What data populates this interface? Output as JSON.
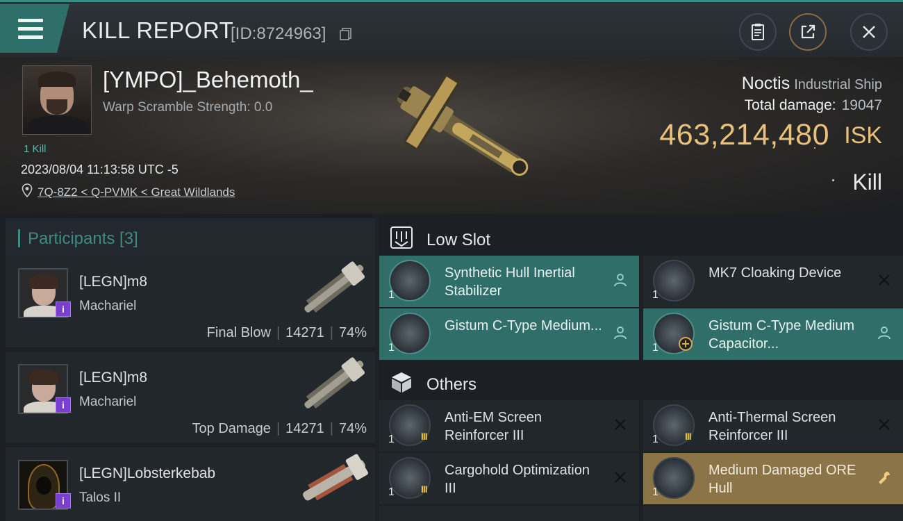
{
  "topbar": {
    "title": "KILL REPORT",
    "report_id": "[ID:8724963]"
  },
  "victim": {
    "name": "[YMPO]_Behemoth_",
    "warp_scramble": "Warp Scramble Strength: 0.0",
    "kill_count": "1 Kill",
    "date": "2023/08/04 11:13:58 UTC -5",
    "location": "7Q-8Z2 < Q-PVMK < Great Wildlands",
    "ship_name": "Noctis",
    "ship_class": "Industrial Ship",
    "total_damage_label": "Total damage:",
    "total_damage": "19047",
    "isk_value": "463,214,480",
    "isk_unit": "ISK",
    "kill_type": "Kill"
  },
  "participants": {
    "title": "Participants [3]",
    "rows": [
      {
        "name": "[LEGN]m8",
        "ship": "Machariel",
        "role": "Final Blow",
        "damage": "14271",
        "percent": "74%",
        "badge": "i"
      },
      {
        "name": "[LEGN]m8",
        "ship": "Machariel",
        "role": "Top Damage",
        "damage": "14271",
        "percent": "74%",
        "badge": "i"
      },
      {
        "name": "[LEGN]Lobsterkebab",
        "ship": "Talos II",
        "role": "",
        "damage": "",
        "percent": "",
        "badge": "i"
      }
    ]
  },
  "fitting": {
    "low_slot_label": "Low Slot",
    "others_label": "Others",
    "low_slot": [
      {
        "name": "Synthetic Hull Inertial Stabilizer",
        "qty": "1",
        "state": "pilot"
      },
      {
        "name": "MK7 Cloaking Device",
        "qty": "1",
        "state": "destroyed"
      },
      {
        "name": "Gistum C-Type Medium...",
        "qty": "1",
        "state": "pilot"
      },
      {
        "name": "Gistum C-Type Medium Capacitor...",
        "qty": "1",
        "state": "pilot"
      }
    ],
    "others": [
      {
        "name": "Anti-EM Screen Reinforcer III",
        "qty": "1",
        "state": "destroyed",
        "tier": "III"
      },
      {
        "name": "Anti-Thermal Screen Reinforcer III",
        "qty": "1",
        "state": "destroyed",
        "tier": "III"
      },
      {
        "name": "Cargohold Optimization III",
        "qty": "1",
        "state": "destroyed",
        "tier": "III"
      },
      {
        "name": "Medium Damaged ORE Hull",
        "qty": "1",
        "state": "repair"
      }
    ]
  },
  "colors": {
    "accent_teal": "#2f6e69",
    "isk_gold": "#e8c27a",
    "repair_gold": "#8a7448",
    "badge_purple": "#7b3fd0"
  },
  "icons": [
    "menu-icon",
    "copy-icon",
    "clipboard-icon",
    "share-icon",
    "close-icon",
    "location-pin-icon",
    "low-slot-icon",
    "cube-icon",
    "person-icon",
    "x-icon",
    "wrench-icon",
    "add-icon"
  ]
}
